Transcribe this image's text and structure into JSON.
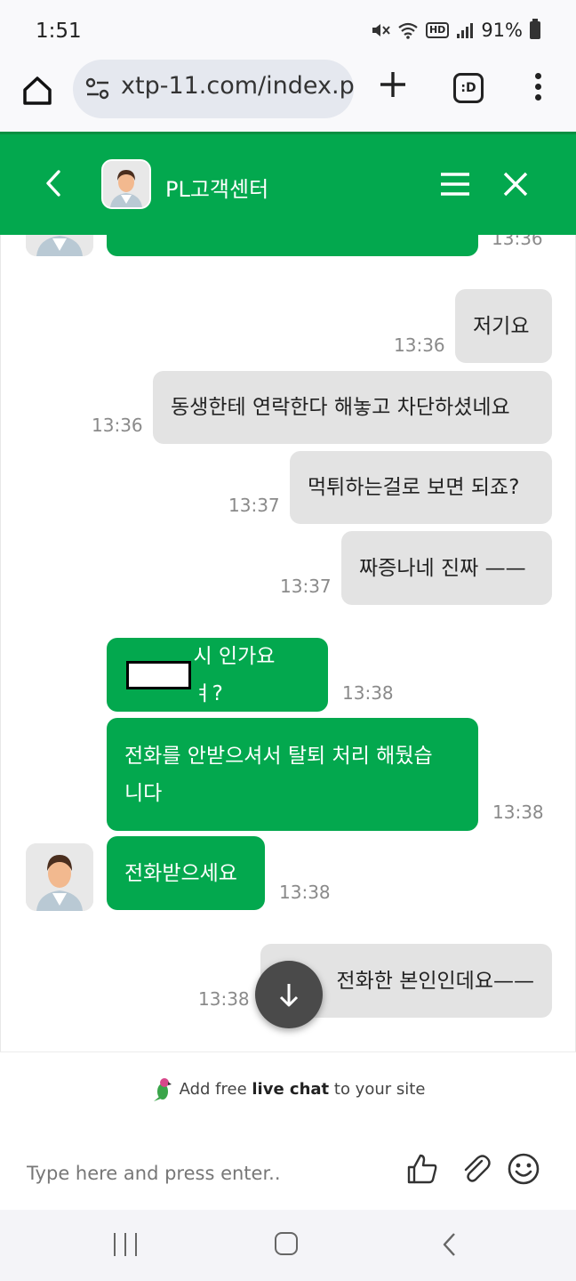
{
  "status_bar": {
    "time": "1:51",
    "battery": "91%",
    "hd_label": "HD"
  },
  "browser": {
    "url": "xtp-11.com/index.p",
    "tabs_label": ":D"
  },
  "chat_header": {
    "title": "PL고객센터",
    "accent_color": "#03a84e"
  },
  "messages": [
    {
      "sender": "user",
      "text": "저기요",
      "time": "13:36"
    },
    {
      "sender": "user",
      "text": "동생한테 연락한다 해놓고 차단하셨네요",
      "time": "13:36"
    },
    {
      "sender": "user",
      "text": "먹튀하는걸로 보면 되죠?",
      "time": "13:37"
    },
    {
      "sender": "user",
      "text": "짜증나네 진짜 ——",
      "time": "13:37"
    },
    {
      "sender": "agent",
      "text": "시 인가요 ㅕ?",
      "time": "13:38"
    },
    {
      "sender": "agent",
      "text_line1": "전화를 안받으셔서 탈퇴 처리 해뒀습",
      "text_line2": "니다",
      "time": "13:38"
    },
    {
      "sender": "agent",
      "text": "전화받으세요",
      "time": "13:38"
    },
    {
      "sender": "user",
      "text": "전화한 본인인데요——",
      "time": "13:38"
    }
  ],
  "partial_top_time": "13:36",
  "composer": {
    "promo_prefix": "Add free ",
    "promo_bold": "live chat",
    "promo_suffix": " to your site",
    "placeholder": "Type here and press enter.."
  }
}
